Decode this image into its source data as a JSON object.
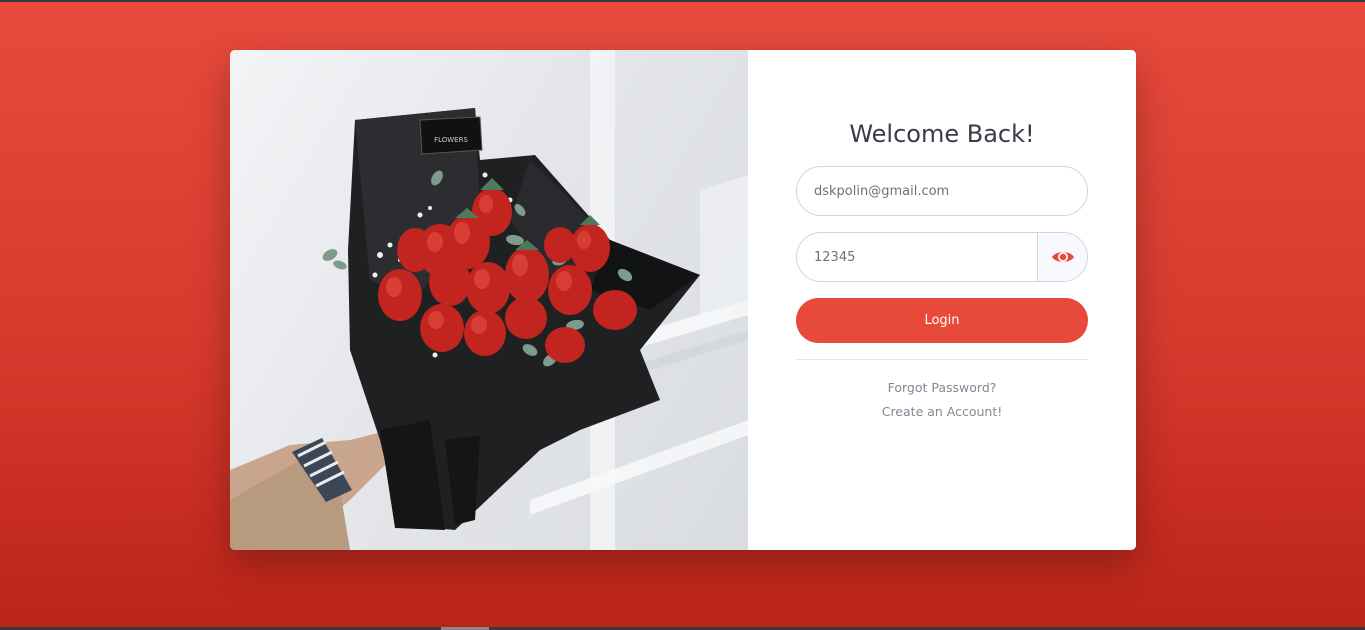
{
  "login": {
    "title": "Welcome Back!",
    "email_value": "dskpolin@gmail.com",
    "password_value": "12345",
    "password_toggle_icon": "eye-icon",
    "login_label": "Login",
    "forgot_label": "Forgot Password?",
    "create_label": "Create an Account!"
  },
  "colors": {
    "accent": "#e74a3b",
    "background_top": "#e84b3c",
    "background_bottom": "#bb2418",
    "text_muted": "#858796"
  }
}
